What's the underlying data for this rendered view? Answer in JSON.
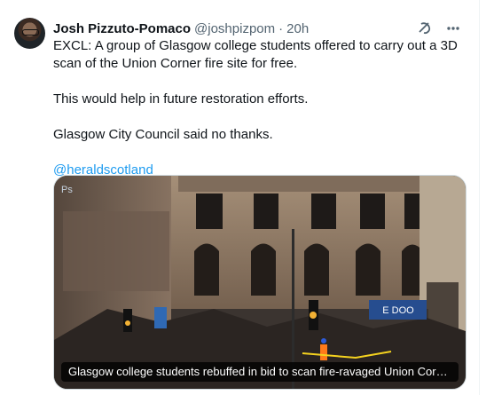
{
  "tweet": {
    "author_name": "Josh Pizzuto-Pomaco",
    "author_handle": "@joshpizpom",
    "separator": "·",
    "time": "20h",
    "paragraphs": [
      "EXCL:  A group of Glasgow college students offered to carry out a 3D scan of the Union Corner fire site for free.",
      "This would help in future restoration efforts.",
      "Glasgow City Council said no thanks."
    ],
    "mention": "@heraldscotland"
  },
  "media": {
    "caption": "Glasgow college students rebuffed in bid to scan fire-ravaged Union Corner fa...",
    "watermark": "Ps",
    "shop_sign": "E  DOO"
  },
  "icons": {
    "grok": "grok-icon",
    "more": "more-icon"
  }
}
